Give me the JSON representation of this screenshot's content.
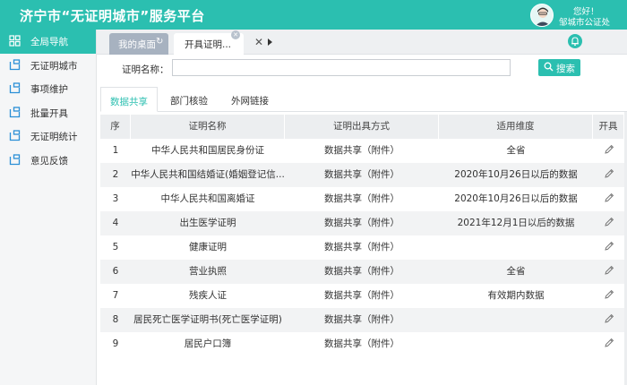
{
  "header": {
    "title": "济宁市“无证明城市”服务平台",
    "greeting": "您好！",
    "user_org": "邹城市公证处"
  },
  "sidebar": {
    "items": [
      {
        "label": "全局导航",
        "icon": "grid-icon",
        "active": true
      },
      {
        "label": "无证明城市",
        "icon": "folder-icon",
        "active": false
      },
      {
        "label": "事项维护",
        "icon": "folder-icon",
        "active": false
      },
      {
        "label": "批量开具",
        "icon": "folder-icon",
        "active": false
      },
      {
        "label": "无证明统计",
        "icon": "folder-icon",
        "active": false
      },
      {
        "label": "意见反馈",
        "icon": "folder-icon",
        "active": false
      }
    ]
  },
  "tabs": {
    "desktop": "我的桌面",
    "current": "开具证明..."
  },
  "search": {
    "label": "证明名称：",
    "value": "",
    "placeholder": "",
    "button": "搜索"
  },
  "subtabs": [
    {
      "label": "数据共享",
      "active": true
    },
    {
      "label": "部门核验",
      "active": false
    },
    {
      "label": "外网链接",
      "active": false
    }
  ],
  "table": {
    "columns": [
      "序",
      "证明名称",
      "证明出具方式",
      "适用维度",
      "开具"
    ],
    "rows": [
      {
        "no": "1",
        "name": "中华人民共和国居民身份证",
        "method": "数据共享（附件）",
        "scope": "全省"
      },
      {
        "no": "2",
        "name": "中华人民共和国结婚证(婚姻登记信...",
        "method": "数据共享（附件）",
        "scope": "2020年10月26日以后的数据"
      },
      {
        "no": "3",
        "name": "中华人民共和国离婚证",
        "method": "数据共享（附件）",
        "scope": "2020年10月26日以后的数据"
      },
      {
        "no": "4",
        "name": "出生医学证明",
        "method": "数据共享（附件）",
        "scope": "2021年12月1日以后的数据"
      },
      {
        "no": "5",
        "name": "健康证明",
        "method": "数据共享（附件）",
        "scope": ""
      },
      {
        "no": "6",
        "name": "营业执照",
        "method": "数据共享（附件）",
        "scope": "全省"
      },
      {
        "no": "7",
        "name": "残疾人证",
        "method": "数据共享（附件）",
        "scope": "有效期内数据"
      },
      {
        "no": "8",
        "name": "居民死亡医学证明书(死亡医学证明)",
        "method": "数据共享（附件）",
        "scope": ""
      },
      {
        "no": "9",
        "name": "居民户口簿",
        "method": "数据共享（附件）",
        "scope": ""
      }
    ]
  },
  "colors": {
    "accent": "#2bbfb0",
    "tab_inactive": "#a7b2c0",
    "sidebar_bg": "#f5f6f7",
    "header_row": "#eceef0",
    "stripe_row": "#f2f3f4"
  }
}
